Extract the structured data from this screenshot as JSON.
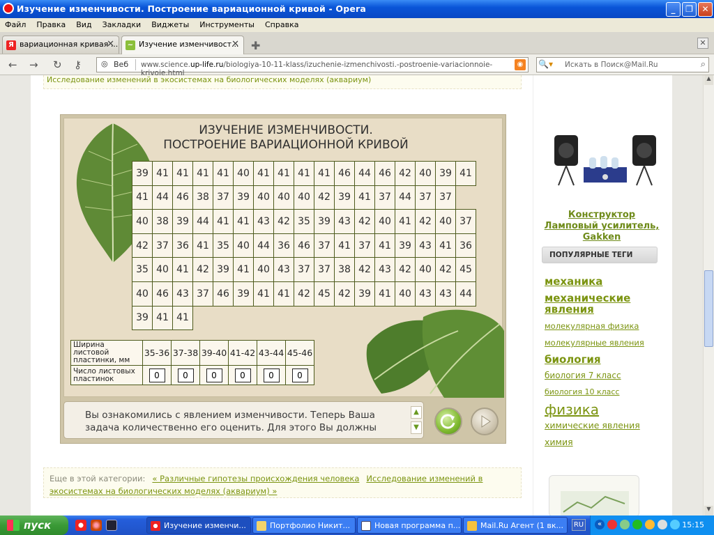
{
  "window": {
    "title": "Изучение изменчивости. Построение вариационной кривой - Opera"
  },
  "menu": [
    "Файл",
    "Правка",
    "Вид",
    "Закладки",
    "Виджеты",
    "Инструменты",
    "Справка"
  ],
  "tabs": [
    {
      "label": "вариационная кривая ..."
    },
    {
      "label": "Изучение изменчивост..."
    }
  ],
  "nav": {
    "web_label": "Веб",
    "url_prefix": "www.science.",
    "url_domain": "up-life.ru",
    "url_path": "/biologiya-10-11-klass/izuchenie-izmenchivosti.-postroenie-variacionnoie-krivoie.html",
    "search_placeholder": "Искать в Поиск@Mail.Ru"
  },
  "page": {
    "top_link": "Исследование изменений в экосистемах на биологических моделях (аквариум)",
    "flash": {
      "title_line1": "ИЗУЧЕНИЕ ИЗМЕНЧИВОСТИ.",
      "title_line2": "ПОСТРОЕНИЕ ВАРИАЦИОННОЙ КРИВОЙ",
      "grid": [
        [
          "39",
          "41",
          "41",
          "41",
          "41",
          "40",
          "41",
          "41",
          "41",
          "41",
          "46",
          "44",
          "46",
          "42",
          "40",
          "39",
          "41"
        ],
        [
          "41",
          "44",
          "46",
          "38",
          "37",
          "39",
          "40",
          "40",
          "40",
          "42",
          "39",
          "41",
          "37",
          "44",
          "37",
          "37"
        ],
        [
          "40",
          "38",
          "39",
          "44",
          "41",
          "41",
          "43",
          "42",
          "35",
          "39",
          "43",
          "42",
          "40",
          "41",
          "42",
          "40",
          "37"
        ],
        [
          "42",
          "37",
          "36",
          "41",
          "35",
          "40",
          "44",
          "36",
          "46",
          "37",
          "41",
          "37",
          "41",
          "39",
          "43",
          "41",
          "36"
        ],
        [
          "35",
          "40",
          "41",
          "42",
          "39",
          "41",
          "40",
          "43",
          "37",
          "37",
          "38",
          "42",
          "43",
          "42",
          "40",
          "42",
          "45"
        ],
        [
          "40",
          "46",
          "43",
          "37",
          "46",
          "39",
          "41",
          "41",
          "42",
          "45",
          "42",
          "39",
          "41",
          "40",
          "43",
          "43",
          "44"
        ],
        [
          "39",
          "41",
          "41"
        ]
      ],
      "freq_row1_label": "Ширина листовой пластинки, мм",
      "freq_row2_label": "Число листовых пластинок",
      "ranges": [
        "35-36",
        "37-38",
        "39-40",
        "41-42",
        "43-44",
        "45-46"
      ],
      "counts": [
        "0",
        "0",
        "0",
        "0",
        "0",
        "0"
      ],
      "message": "Вы ознакомились с явлением изменчивости. Теперь Ваша задача количественно его оценить. Для этого Вы должны"
    },
    "footer": {
      "prefix": "Еще в этой категории:",
      "link1": "« Различные гипотезы происхождения человека",
      "link2": "Исследование изменений в экосистемах на биологических моделях (аквариум) »"
    }
  },
  "sidebar": {
    "ad_link": "Конструктор Ламповый усилитель, Gakken",
    "tags_header": "ПОПУЛЯРНЫЕ ТЕГИ",
    "tags": [
      {
        "label": "механика"
      },
      {
        "label": "механические явления"
      },
      {
        "label": "молекулярная физика"
      },
      {
        "label": "молекулярные явления"
      },
      {
        "label": "биология"
      },
      {
        "label": "биология 7 класс"
      },
      {
        "label": "биология 10 класс"
      },
      {
        "label": "физика"
      },
      {
        "label": "химические явления"
      },
      {
        "label": "химия"
      }
    ]
  },
  "taskbar": {
    "start": "пуск",
    "tasks": [
      {
        "label": "Изучение изменчи..."
      },
      {
        "label": "Портфолио Никит..."
      },
      {
        "label": "Новая программа п..."
      },
      {
        "label": "Mail.Ru Агент (1 вк..."
      }
    ],
    "lang": "RU",
    "clock": "15:15"
  }
}
